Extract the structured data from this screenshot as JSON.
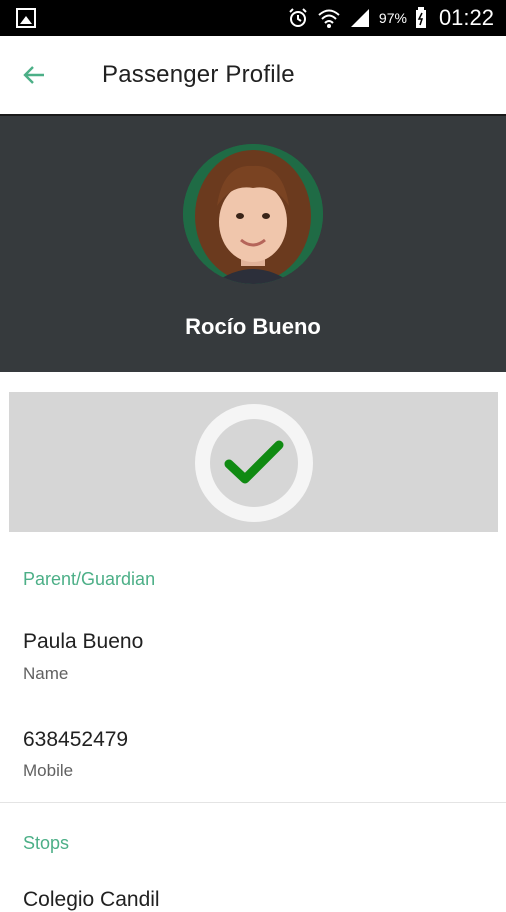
{
  "status_bar": {
    "battery": "97%",
    "time": "01:22",
    "icons": [
      "gallery-icon",
      "alarm-icon",
      "wifi-icon",
      "signal-icon",
      "battery-icon"
    ]
  },
  "app_bar": {
    "title": "Passenger Profile",
    "back_icon": "arrow-left-icon"
  },
  "profile": {
    "name": "Rocío Bueno",
    "avatar": "child-photo"
  },
  "status_panel": {
    "icon": "check-icon",
    "accent_color": "#108a12"
  },
  "parent_guardian": {
    "section_title": "Parent/Guardian",
    "name_value": "Paula Bueno",
    "name_label": "Name",
    "mobile_value": "638452479",
    "mobile_label": "Mobile"
  },
  "stops": {
    "section_title": "Stops",
    "first_stop_partial": "Colegio Candil"
  },
  "colors": {
    "accent": "#4caf87",
    "header_bg": "#363a3d",
    "panel_bg": "#d6d6d6"
  }
}
